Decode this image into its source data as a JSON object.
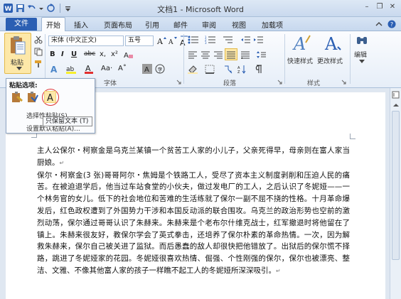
{
  "window": {
    "title": "文档1 - Microsoft Word"
  },
  "ribbon": {
    "file_tab": "文件",
    "tabs": [
      "开始",
      "插入",
      "页面布局",
      "引用",
      "邮件",
      "审阅",
      "视图",
      "加载项"
    ],
    "clipboard": {
      "paste_label": "粘贴",
      "group_label": "剪"
    },
    "font": {
      "name": "宋体 (中文正文)",
      "size": "五号",
      "group_label": "字体"
    },
    "paragraph": {
      "group_label": "段落"
    },
    "styles": {
      "quick_styles": "快速样式",
      "change_styles": "更改样式",
      "group_label": "样式"
    },
    "editing": {
      "label": "编辑"
    }
  },
  "paste_popup": {
    "title": "粘贴选项:",
    "menu_item_1": "选择性粘贴(S)...",
    "menu_item_2": "设置默认粘贴(A)...",
    "tooltip": "只保留文本 (T)"
  },
  "document": {
    "paragraph_1": "主人公保尔・柯察金是乌克兰某镇一个贫苦工人家的小儿子，父亲死得早，母亲则在富人家当厨娘。",
    "paragraph_2": "保尔・柯察金(3 张)哥哥阿尔・焦姆是个铁路工人，受尽了资本主义制度剥削和压迫人民的痛苦。在被迫退学后，他当过车站食堂的小伙夫，做过发电厂的工人，之后认识了冬妮娅——一个林务官的女儿。低下的社会地位和苦难的生活练就了保尔一副不屈不挠的性格。十月革命爆发后，红色政权遭到了外国势力干涉和本国反动派的联合围攻。乌克兰的政治形势也空前的激烈动荡，保尔通过哥哥认识了朱赫来。朱赫来是个老布尔什维克战士，红军撤退时将他留在了镇上。朱赫来很友好，教保尔学会了英式拳击，还培养了保尔朴素的革命热情。一次，因为解救朱赫来，保尔自己被关进了监狱。而后愚蠢的敌人却很快把他错放了。出狱后的保尔慌不择路，跳进了冬妮娅家的花园。冬妮娅很喜欢热情、倔强、个性刚强的保尔，保尔也被漂亮、整洁、文雅、不像其他富人家的孩子一样瞧不起工人的冬妮娅所深深吸引。"
  }
}
